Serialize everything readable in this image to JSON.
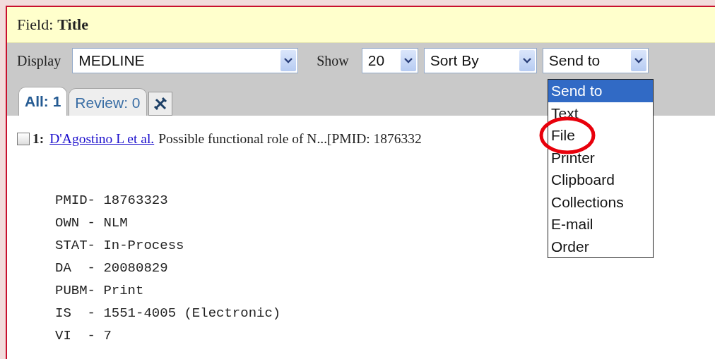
{
  "field_bar": {
    "label": "Field:",
    "value": "Title"
  },
  "toolbar": {
    "display_label": "Display",
    "display_select": "MEDLINE",
    "show_label": "Show",
    "show_select": "20",
    "sort_select": "Sort By",
    "send_select": "Send to"
  },
  "tabs": [
    {
      "label": "All: 1",
      "selected": true
    },
    {
      "label": "Review: 0",
      "selected": false
    }
  ],
  "send_menu": {
    "options": [
      {
        "label": "Send to",
        "selected": true,
        "circled": false
      },
      {
        "label": "Text",
        "selected": false,
        "circled": false
      },
      {
        "label": "File",
        "selected": false,
        "circled": true
      },
      {
        "label": "Printer",
        "selected": false,
        "circled": false
      },
      {
        "label": "Clipboard",
        "selected": false,
        "circled": false
      },
      {
        "label": "Collections",
        "selected": false,
        "circled": false
      },
      {
        "label": "E-mail",
        "selected": false,
        "circled": false
      },
      {
        "label": "Order",
        "selected": false,
        "circled": false
      }
    ]
  },
  "result": {
    "checked": false,
    "number": "1:",
    "authors": "D'Agostino L et al.",
    "summary": "Possible functional role of N...[PMID: 1876332"
  },
  "record_lines": [
    "PMID- 18763323",
    "OWN - NLM",
    "STAT- In-Process",
    "DA  - 20080829",
    "PUBM- Print",
    "IS  - 1551-4005 (Electronic)",
    "VI  - 7"
  ]
}
